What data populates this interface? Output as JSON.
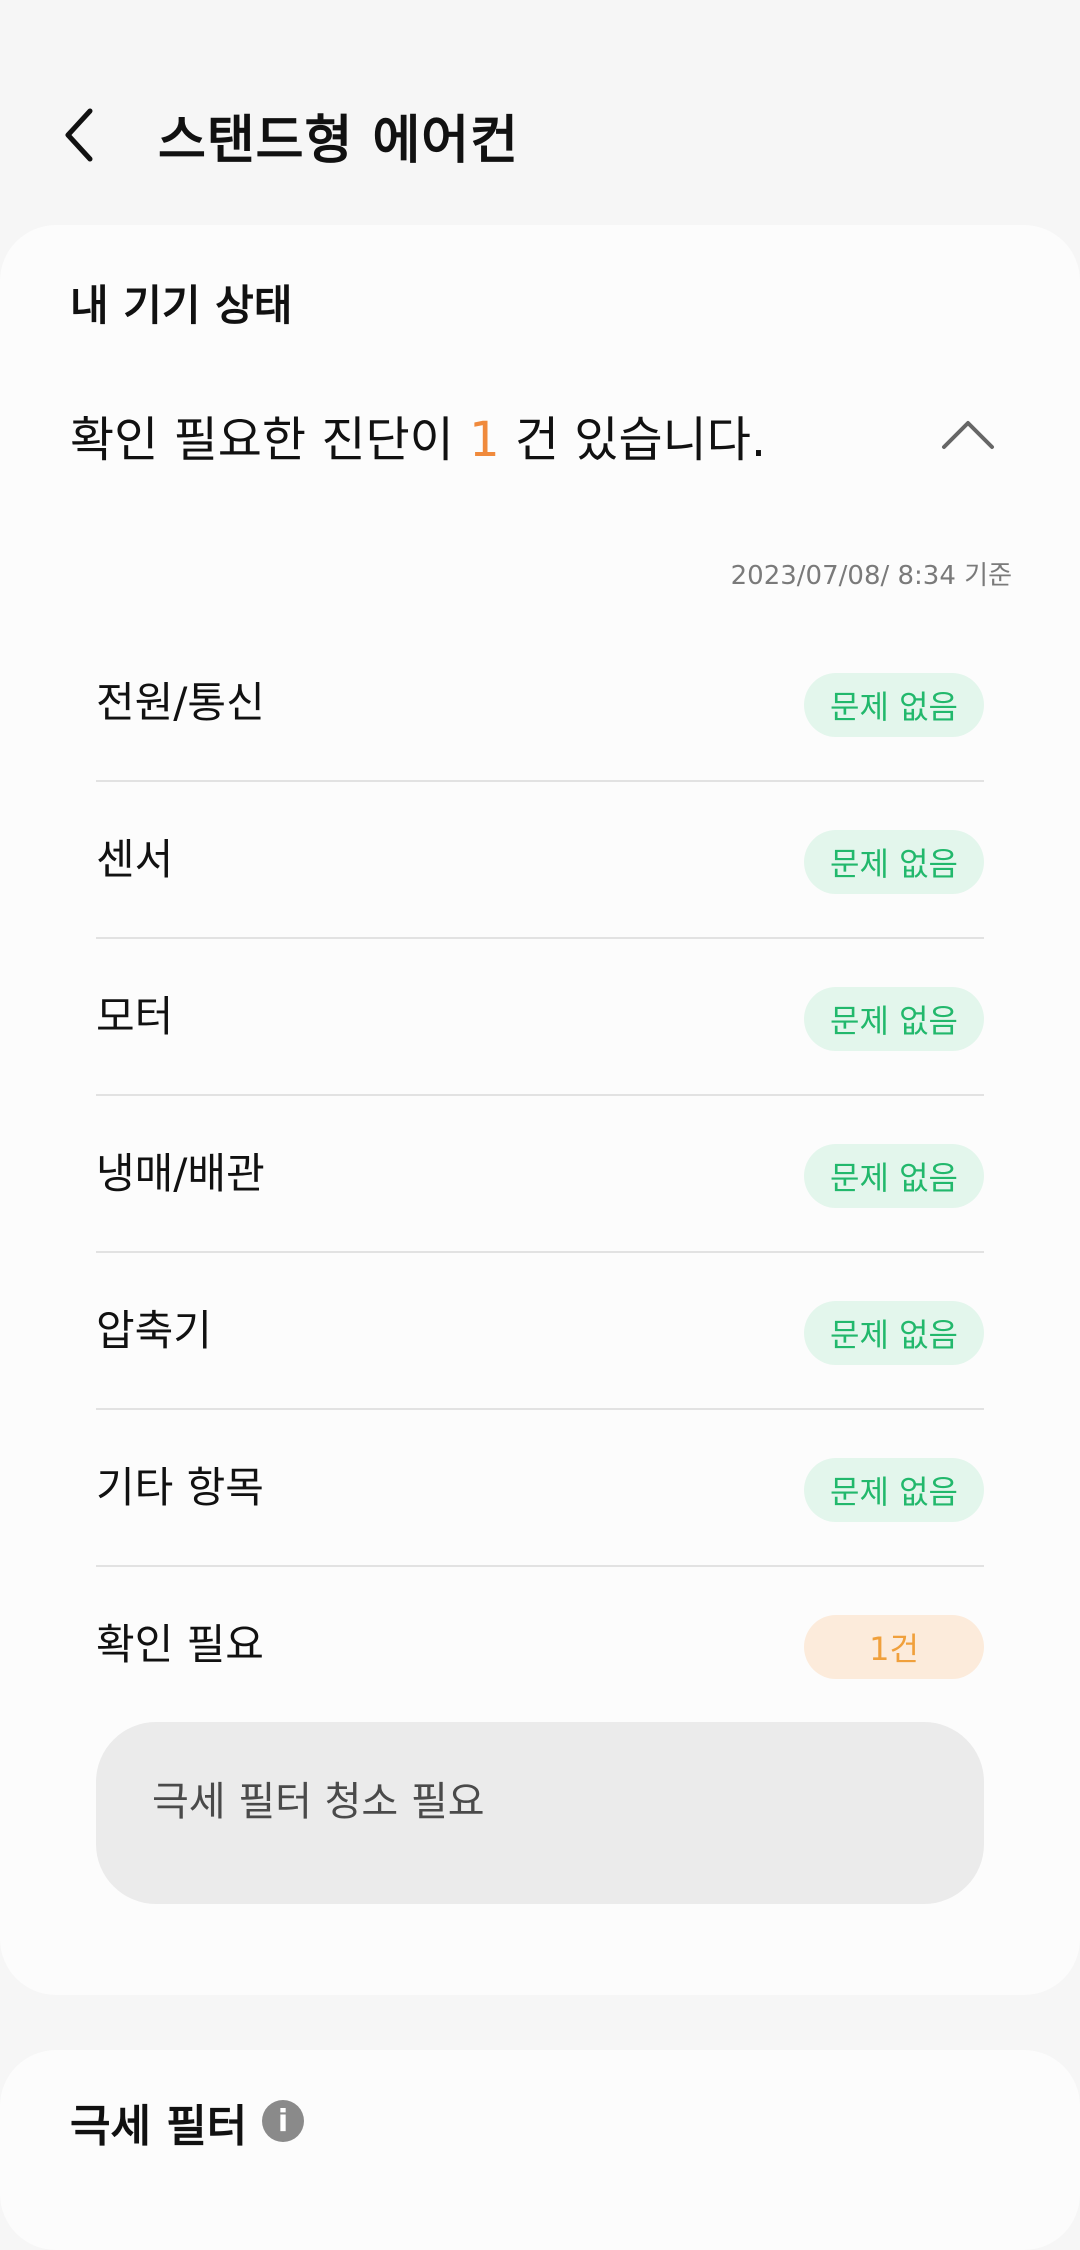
{
  "header": {
    "title": "스탠드형 에어컨",
    "back_icon": "chevron-left-icon"
  },
  "status": {
    "section_title": "내 기기 상태",
    "summary_prefix": "확인 필요한 진단이 ",
    "summary_count": "1",
    "summary_suffix": " 건 있습니다.",
    "collapse_icon": "chevron-up-icon",
    "timestamp": "2023/07/08/ 8:34 기준",
    "items": [
      {
        "label": "전원/통신",
        "badge": "문제 없음",
        "state": "ok"
      },
      {
        "label": "센서",
        "badge": "문제 없음",
        "state": "ok"
      },
      {
        "label": "모터",
        "badge": "문제 없음",
        "state": "ok"
      },
      {
        "label": "냉매/배관",
        "badge": "문제 없음",
        "state": "ok"
      },
      {
        "label": "압축기",
        "badge": "문제 없음",
        "state": "ok"
      },
      {
        "label": "기타 항목",
        "badge": "문제 없음",
        "state": "ok"
      },
      {
        "label": "확인 필요",
        "badge": "1건",
        "state": "warn"
      }
    ],
    "detail": "극세 필터 청소 필요"
  },
  "filter": {
    "title": "극세 필터",
    "info_icon": "info-icon",
    "info_glyph": "i"
  },
  "colors": {
    "ok": "#22b86c",
    "warn": "#f0a03c",
    "count": "#f08a3c"
  }
}
